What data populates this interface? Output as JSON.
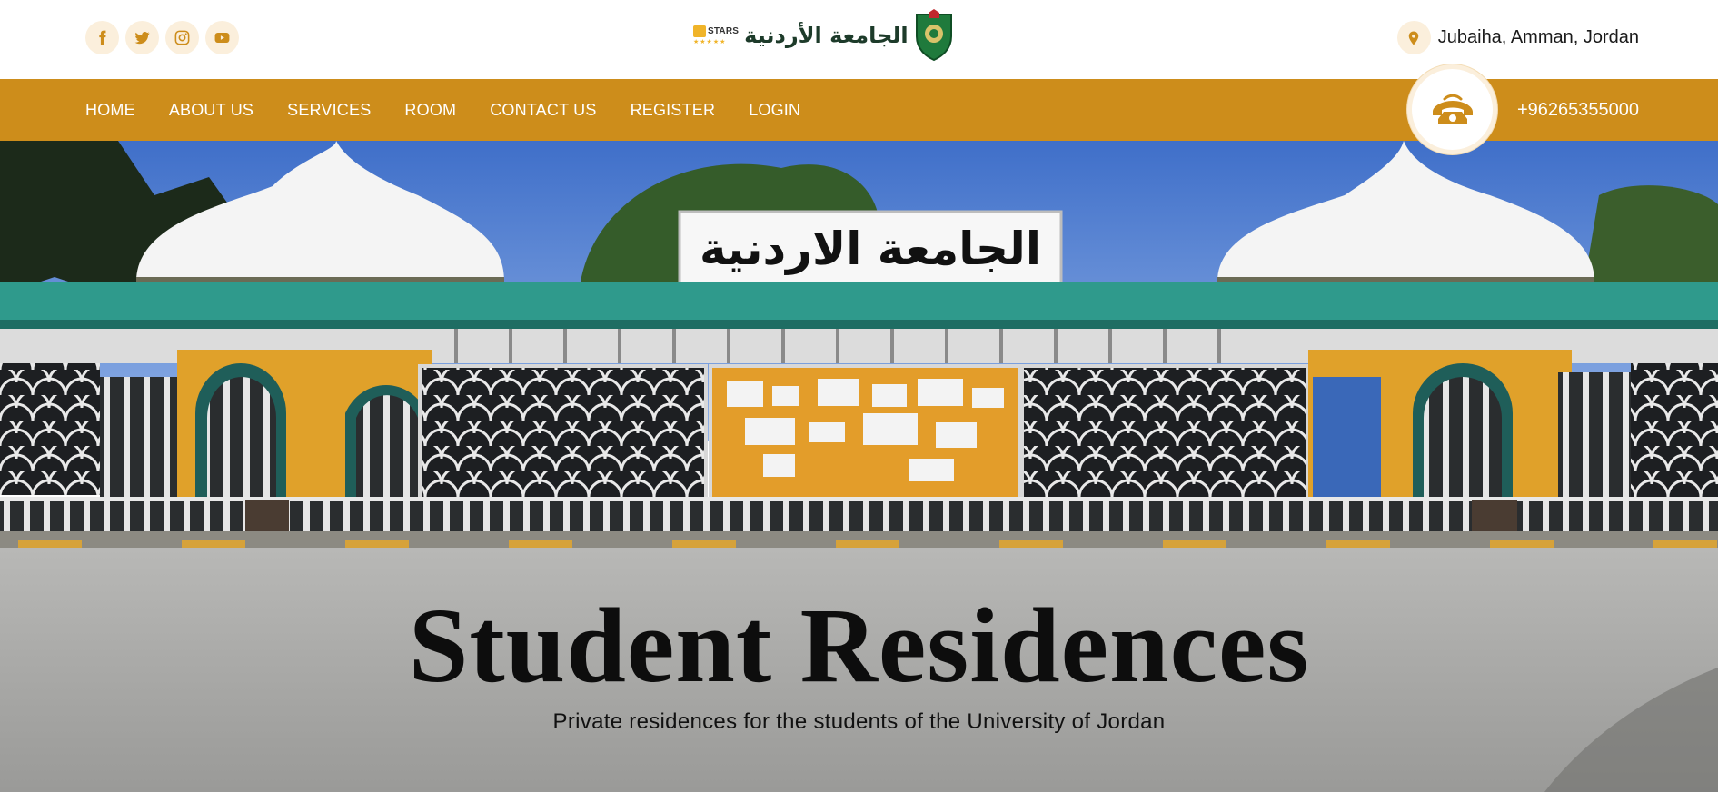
{
  "topbar": {
    "socials": [
      {
        "icon": "facebook-icon"
      },
      {
        "icon": "twitter-icon"
      },
      {
        "icon": "instagram-icon"
      },
      {
        "icon": "youtube-icon"
      }
    ],
    "logo": {
      "badge_text": "STARS",
      "university_name": "الجامعة الأردنية"
    },
    "location": {
      "icon": "map-pin-icon",
      "text": "Jubaiha, Amman, Jordan"
    }
  },
  "nav": {
    "items": [
      {
        "label": "HOME"
      },
      {
        "label": "ABOUT US"
      },
      {
        "label": "SERVICES"
      },
      {
        "label": "ROOM"
      },
      {
        "label": "CONTACT US"
      },
      {
        "label": "REGISTER"
      },
      {
        "label": "LOGIN"
      }
    ],
    "phone": {
      "icon": "phone-icon",
      "number": "+96265355000"
    }
  },
  "hero": {
    "sign_text": "الجامعة الاردنية",
    "title": "Student Residences",
    "subtitle": "Private residences for the students of the University of Jordan"
  },
  "colors": {
    "accent": "#cd8d1b",
    "icon_bg": "#fbefdc",
    "teal": "#2f9a8c"
  }
}
